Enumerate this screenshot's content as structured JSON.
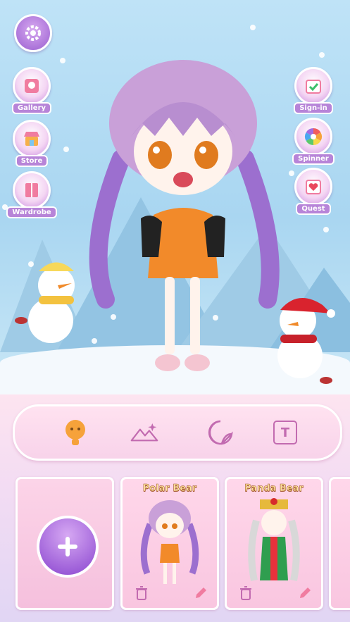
{
  "side_buttons_left": [
    {
      "id": "settings",
      "label": "",
      "icon": "gear-icon"
    },
    {
      "id": "gallery",
      "label": "Gallery",
      "icon": "gallery-icon"
    },
    {
      "id": "store",
      "label": "Store",
      "icon": "store-icon"
    },
    {
      "id": "wardrobe",
      "label": "Wardrobe",
      "icon": "wardrobe-icon"
    }
  ],
  "side_buttons_right": [
    {
      "id": "sign-in",
      "label": "Sign-in",
      "icon": "calendar-check-icon"
    },
    {
      "id": "spinner",
      "label": "Spinner",
      "icon": "color-wheel-icon"
    },
    {
      "id": "quest",
      "label": "Quest",
      "icon": "heart-calendar-icon"
    }
  ],
  "toolbar": {
    "tools": [
      {
        "id": "character",
        "icon": "character-icon",
        "selected": true
      },
      {
        "id": "background",
        "icon": "mountain-icon",
        "selected": false
      },
      {
        "id": "sticker",
        "icon": "sticker-icon",
        "selected": false
      },
      {
        "id": "text",
        "icon": "text-icon",
        "label": "T",
        "selected": false
      }
    ]
  },
  "cards": [
    {
      "id": "add",
      "title": "",
      "icon": "plus-icon"
    },
    {
      "id": "polar-bear",
      "title": "Polar Bear"
    },
    {
      "id": "panda-bear",
      "title": "Panda Bear"
    }
  ],
  "colors": {
    "accent": "#b784d8",
    "pink": "#f9c6e0",
    "sky": "#a9d6f1"
  }
}
